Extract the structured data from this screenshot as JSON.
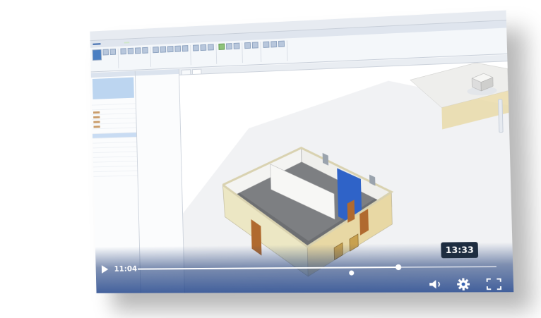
{
  "player": {
    "current_time": "11:04",
    "hover_time": "13:33",
    "progress_fraction": 0.74
  },
  "icons": {
    "play": "play-icon",
    "volume": "volume-icon",
    "settings": "gear-icon",
    "fullscreen": "fullscreen-icon"
  },
  "colors": {
    "scrim": "#23468c",
    "wall": "#e8d8a4",
    "door": "#b06a2f",
    "accent_wall": "#2f63c8"
  }
}
